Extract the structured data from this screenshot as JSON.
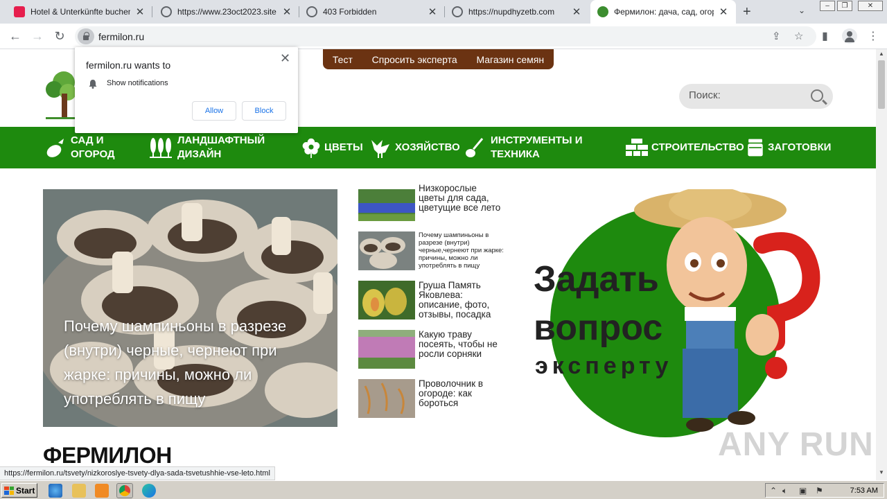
{
  "browser": {
    "tabs": [
      {
        "title": "Hotel & Unterkünfte buchen | Airbnb",
        "active": false
      },
      {
        "title": "https://www.23oct2023.site",
        "active": false
      },
      {
        "title": "403 Forbidden",
        "active": false
      },
      {
        "title": "https://nupdhyzetb.com",
        "active": false
      },
      {
        "title": "Фермилон: дача, сад, огород",
        "active": true
      }
    ],
    "url": "fermilon.ru",
    "status_url": "https://fermilon.ru/tsvety/nizkoroslye-tsvety-dlya-sada-tsvetushhie-vse-leto.html"
  },
  "notification_popup": {
    "title": "fermilon.ru wants to",
    "permission": "Show notifications",
    "allow_label": "Allow",
    "block_label": "Block"
  },
  "site": {
    "top_menu": [
      "Тест",
      "Спросить эксперта",
      "Магазин семян"
    ],
    "search_placeholder": "Поиск:",
    "nav": [
      {
        "label_line1": "Сад и",
        "label_line2": "огород",
        "icon": "eggplant-icon"
      },
      {
        "label_line1": "Ландшафтный",
        "label_line2": "дизайн",
        "icon": "trees-icon"
      },
      {
        "label_line1": "Цветы",
        "label_line2": "",
        "icon": "flower-icon"
      },
      {
        "label_line1": "Хозяйство",
        "label_line2": "",
        "icon": "rooster-icon"
      },
      {
        "label_line1": "Инструменты и",
        "label_line2": "техника",
        "icon": "shovel-icon"
      },
      {
        "label_line1": "Строительство",
        "label_line2": "",
        "icon": "bricks-icon"
      },
      {
        "label_line1": "Заготовки",
        "label_line2": "",
        "icon": "jar-icon"
      }
    ],
    "hero_title": "Почему шампиньоны в разрезе (внутри) черные, чернеют при жарке: причины, можно ли употреблять в пищу",
    "side_articles": [
      {
        "title": "Низкорослые цветы для сада, цветущие все лето"
      },
      {
        "title": "Почему шампиньоны в разрезе (внутри) черные,чернеют при жарке: причины, можно ли употреблять в пищу"
      },
      {
        "title": "Груша Память Яковлева: описание, фото, отзывы, посадка"
      },
      {
        "title": "Какую траву посеять, чтобы не росли сорняки"
      },
      {
        "title": "Проволочник в огороде: как бороться"
      }
    ],
    "expert_banner": {
      "line1": "Задать",
      "line2": "вопрос",
      "line3": "эксперту"
    },
    "site_title": "ФЕРМИЛОН"
  },
  "watermark": "ANY RUN",
  "taskbar": {
    "start_label": "Start",
    "clock": "7:53 AM"
  },
  "colors": {
    "green_nav": "#1e8a0e",
    "brown_menu": "#6b3312",
    "expert_green": "#1e8a0e"
  }
}
